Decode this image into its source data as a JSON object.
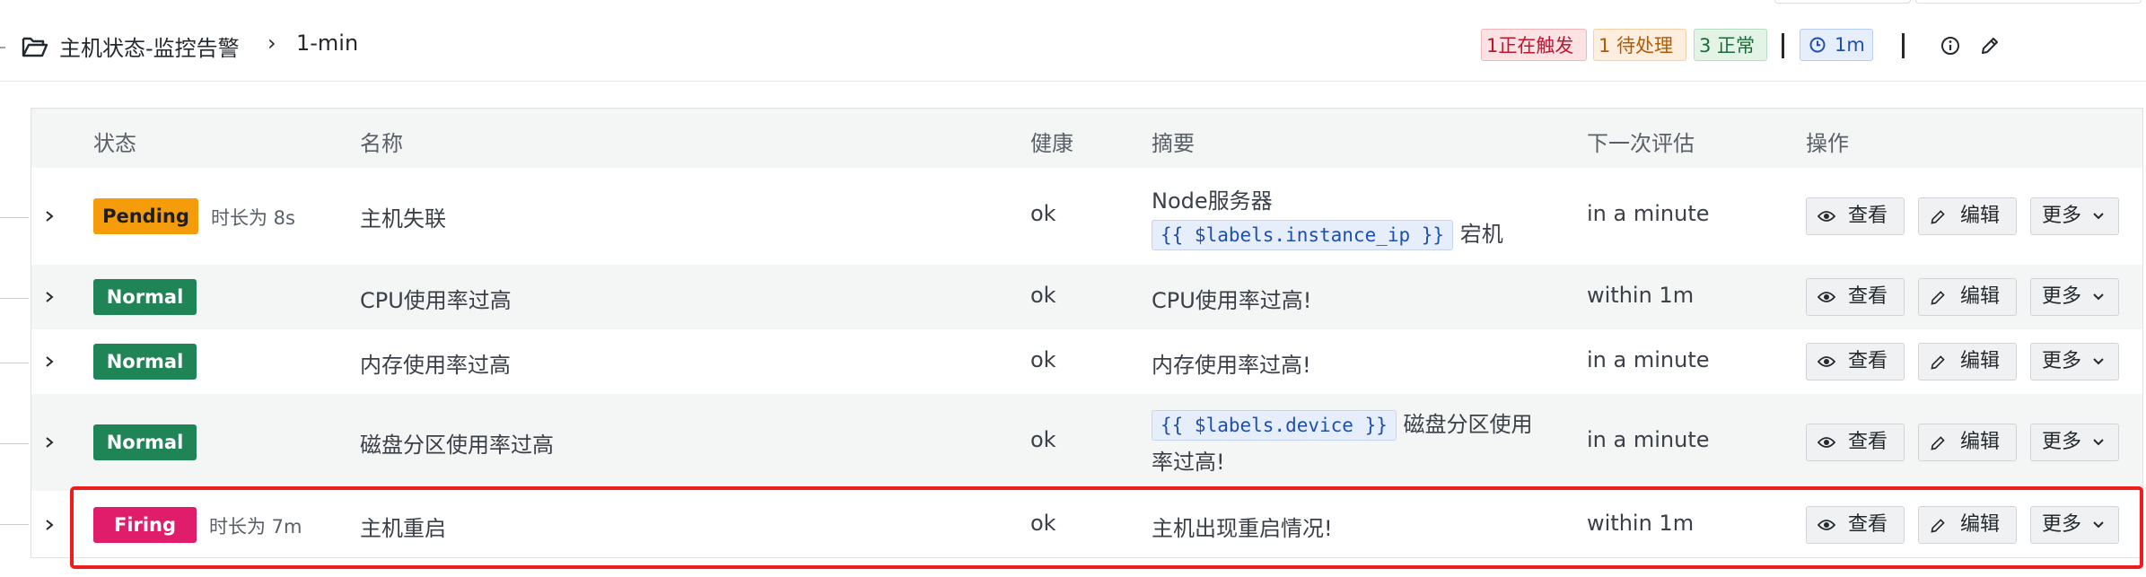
{
  "breadcrumb": {
    "folder": "主机状态-监控告警",
    "separator": "›",
    "current": "1-min"
  },
  "summary": {
    "firing": "1正在触发",
    "pending": "1 待处理",
    "normal": "3 正常",
    "interval": "1m"
  },
  "table": {
    "headers": {
      "state": "状态",
      "name": "名称",
      "health": "健康",
      "summary": "摘要",
      "next_eval": "下一次评估",
      "actions": "操作"
    },
    "action_labels": {
      "view": "查看",
      "edit": "编辑",
      "more": "更多"
    },
    "rows": [
      {
        "state": "Pending",
        "duration": "时长为 8s",
        "name": "主机失联",
        "health": "ok",
        "summary_line1": "Node服务器",
        "summary_code": "{{ $labels.instance_ip }}",
        "summary_after": "宕机",
        "next_eval": "in a minute"
      },
      {
        "state": "Normal",
        "duration": "",
        "name": "CPU使用率过高",
        "health": "ok",
        "summary": "CPU使用率过高!",
        "next_eval": "within 1m"
      },
      {
        "state": "Normal",
        "duration": "",
        "name": "内存使用率过高",
        "health": "ok",
        "summary": "内存使用率过高!",
        "next_eval": "in a minute"
      },
      {
        "state": "Normal",
        "duration": "",
        "name": "磁盘分区使用率过高",
        "health": "ok",
        "summary_code": "{{ $labels.device }}",
        "summary_after": "磁盘分区使用",
        "summary_line2": "率过高!",
        "next_eval": "in a minute"
      },
      {
        "state": "Firing",
        "duration": "时长为 7m",
        "name": "主机重启",
        "health": "ok",
        "summary": "主机出现重启情况!",
        "next_eval": "within 1m"
      }
    ]
  },
  "colors": {
    "pending": "#f59c0b",
    "normal": "#1f8456",
    "firing": "#e01d6b",
    "highlight": "#ee1c1c"
  }
}
